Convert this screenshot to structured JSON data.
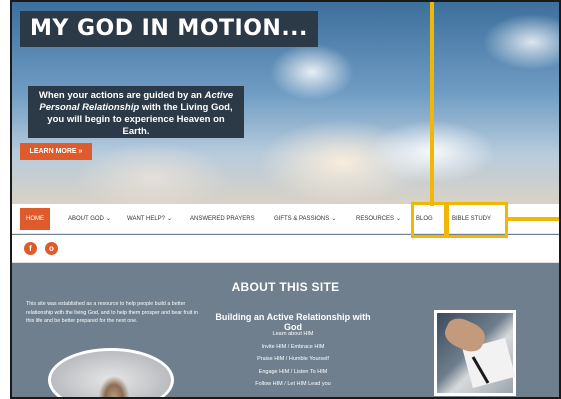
{
  "hero": {
    "title": "MY GOD IN MOTION...",
    "tagline_line1": "When your actions are guided by an",
    "tagline_em": "Active Personal Relationship",
    "tagline_line2": "with the Living God, you will begin to experience Heaven on Earth.",
    "cta_label": "LEARN MORE »"
  },
  "nav": {
    "items": [
      {
        "label": "HOME",
        "active": true
      },
      {
        "label": "ABOUT GOD",
        "caret": "⌄"
      },
      {
        "label": "WANT HELP?",
        "caret": "⌄"
      },
      {
        "label": "ANSWERED PRAYERS"
      },
      {
        "label": "GIFTS & PASSIONS",
        "caret": "⌄"
      },
      {
        "label": "RESOURCES",
        "caret": "⌄"
      },
      {
        "label": "BLOG"
      },
      {
        "label": "BIBLE STUDY"
      }
    ]
  },
  "social": {
    "facebook_glyph": "f",
    "other_glyph": "o"
  },
  "about": {
    "title": "ABOUT THIS SITE",
    "left_text": "This site was established as a resource to help people build a better relationship with the living God, and to help them prosper and bear fruit in this life and be better prepared for the next one.",
    "mid_heading": "Building an Active Relationship with God",
    "list": [
      "Learn about HIM",
      "Invite HIM / Embrace HIM",
      "Praise HIM / Humble Yourself",
      "Engage HIM / Listen To HIM",
      "Follow HIM / Let HIM Lead you"
    ]
  },
  "colors": {
    "accent": "#e05b2b",
    "annotation": "#f2b705",
    "panel": "#2c3a48",
    "section_bg": "#6f7f8d"
  }
}
